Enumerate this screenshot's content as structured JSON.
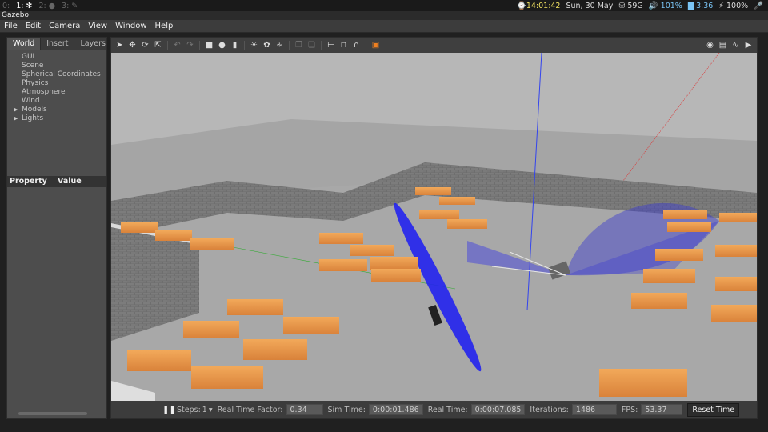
{
  "topbar": {
    "workspaces": [
      {
        "label": "0:",
        "icon": "pointer-icon"
      },
      {
        "label": "1: ✻",
        "icon": "snowflake-icon"
      },
      {
        "label": "2: ●",
        "icon": "chrome-icon"
      },
      {
        "label": "3: ✎",
        "icon": "edit-icon"
      }
    ],
    "clock": "⌚14:01:42",
    "date": "Sun, 30 May",
    "disk": "⛁ 59G",
    "volume": "🔊 101%",
    "load": "▇ 3.36",
    "battery": "⚡ 100%",
    "mic": "🎤"
  },
  "window": {
    "title": "Gazebo"
  },
  "menu": [
    "File",
    "Edit",
    "Camera",
    "View",
    "Window",
    "Help"
  ],
  "left_panel": {
    "tabs": [
      "World",
      "Insert",
      "Layers"
    ],
    "tree": [
      {
        "label": "GUI",
        "expandable": false
      },
      {
        "label": "Scene",
        "expandable": false
      },
      {
        "label": "Spherical Coordinates",
        "expandable": false
      },
      {
        "label": "Physics",
        "expandable": false
      },
      {
        "label": "Atmosphere",
        "expandable": false
      },
      {
        "label": "Wind",
        "expandable": false
      },
      {
        "label": "Models",
        "expandable": true
      },
      {
        "label": "Lights",
        "expandable": true
      }
    ],
    "property_header": {
      "property": "Property",
      "value": "Value"
    }
  },
  "bottom_bar": {
    "steps_label": "Steps:",
    "steps_value": "1",
    "rtf_label": "Real Time Factor:",
    "rtf_value": "0.34",
    "sim_label": "Sim Time:",
    "sim_value": "0:00:01.486",
    "real_label": "Real Time:",
    "real_value": "0:00:07.085",
    "iter_label": "Iterations:",
    "iter_value": "1486",
    "fps_label": "FPS:",
    "fps_value": "53.37",
    "reset_label": "Reset Time"
  },
  "toolbar_icons": [
    "select-arrow-icon",
    "translate-icon",
    "rotate-icon",
    "scale-icon",
    "undo-icon",
    "redo-icon",
    "box-icon",
    "sphere-icon",
    "cylinder-icon",
    "point-light-icon",
    "spot-light-icon",
    "directional-light-icon",
    "copy-icon",
    "paste-icon",
    "align-icon",
    "snap-icon",
    "magnet-icon",
    "view-angle-icon"
  ],
  "toolbar_right_icons": [
    "screenshot-icon",
    "log-icon",
    "plot-icon",
    "video-icon"
  ]
}
